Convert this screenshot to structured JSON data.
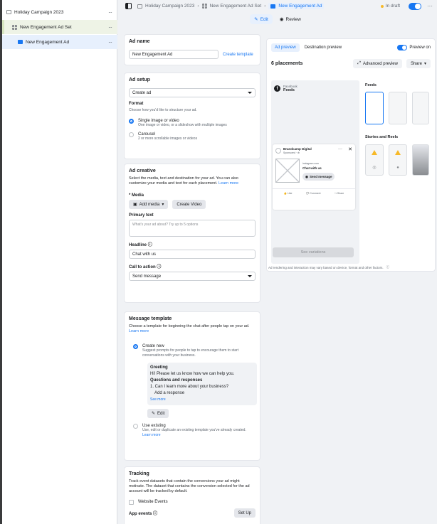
{
  "nav": {
    "campaign": "Holiday Campaign 2023",
    "adset": "New Engagement Ad Set",
    "ad": "New Engagement Ad"
  },
  "topbar": {
    "crumb1": "Holiday Campaign 2023",
    "crumb2": "New Engagement Ad Set",
    "crumb3": "New Engagement Ad",
    "status": "In draft",
    "more": "···"
  },
  "modes": {
    "edit": "Edit",
    "review": "Review"
  },
  "ad_name": {
    "title": "Ad name",
    "value": "New Engagement Ad",
    "create_template": "Create template"
  },
  "ad_setup": {
    "title": "Ad setup",
    "select": "Create ad",
    "format_label": "Format",
    "format_help": "Choose how you'd like to structure your ad.",
    "single_title": "Single image or video",
    "single_desc": "One image or video, or a slideshow with multiple images",
    "carousel_title": "Carousel",
    "carousel_desc": "2 or more scrollable images or videos"
  },
  "creative": {
    "title": "Ad creative",
    "desc": "Select the media, text and destination for your ad. You can also customize your media and text for each placement.",
    "learn_more": "Learn more",
    "media_label": "* Media",
    "add_media": "Add media",
    "create_video": "Create Video",
    "primary_label": "Primary text",
    "primary_placeholder": "What's your ad about? Try up to 5 options",
    "headline_label": "Headline",
    "headline_value": "Chat with us",
    "cta_label": "Call to action",
    "cta_value": "Send message"
  },
  "message_template": {
    "title": "Message template",
    "desc": "Choose a template for beginning the chat after people tap on your ad.",
    "learn_more": "Learn more",
    "create_new": "Create new",
    "create_new_desc": "Suggest prompts for people to tap to encourage them to start conversations with your business.",
    "greeting_label": "Greeting",
    "greeting_text": "Hi! Please let us know how we can help you.",
    "qr_label": "Questions and responses",
    "question": "1. Can I learn more about your business?",
    "add_response": "Add a response",
    "see_more": "See more",
    "edit": "Edit",
    "use_existing": "Use existing",
    "use_existing_desc": "Use, edit or duplicate an existing template you've already created.",
    "learn_more2": "Learn more"
  },
  "tracking": {
    "title": "Tracking",
    "desc": "Track event datasets that contain the conversions your ad might motivate. The dataset that contains the conversion selected for the ad account will be tracked by default.",
    "website_events": "Website Events",
    "app_events": "App events",
    "set_up": "Set Up"
  },
  "preview": {
    "tab_ad": "Ad preview",
    "tab_dest": "Destination preview",
    "preview_on": "Preview on",
    "placements": "6 placements",
    "advanced": "Advanced preview",
    "share": "Share",
    "fb_label": "Facebook",
    "feeds_label": "Feeds",
    "brand": "Brandcamp Digital",
    "sponsored": "Sponsored · ⊕",
    "site": "instagram.com",
    "chat": "Chat with us",
    "send_message": "Send message",
    "like": "Like",
    "comment": "Comment",
    "share_action": "Share",
    "see_variations": "See variations",
    "feeds_section": "Feeds",
    "stories_section": "Stories and Reels",
    "footnote": "Ad rendering and interaction may vary based on device, format and other factors."
  }
}
